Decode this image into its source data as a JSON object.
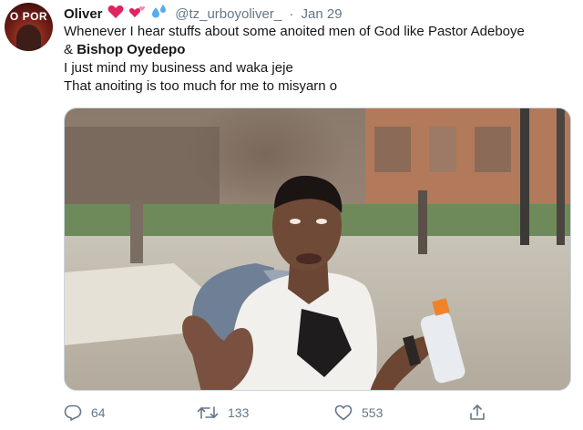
{
  "tweet": {
    "author_name": "Oliver",
    "handle": "@tz_urboyoliver_",
    "separator": "·",
    "date": "Jan 29",
    "avatar_text": "O POR",
    "lines": [
      "Whenever I hear stuffs about some anoited men of God like Pastor Adeboye",
      "& ",
      "Bishop Oyedepo",
      "I just mind my business and waka jeje",
      "That anoiting is too much for me to misyarn o"
    ],
    "name_emojis": [
      "red-heart-icon",
      "revolving-hearts-icon",
      "sweat-droplets-icon"
    ],
    "colors": {
      "text": "#14171a",
      "secondary": "#657786",
      "heart": "#e0245e",
      "droplets": "#55acee"
    }
  },
  "actions": {
    "reply_count": "64",
    "retweet_count": "133",
    "like_count": "553"
  }
}
